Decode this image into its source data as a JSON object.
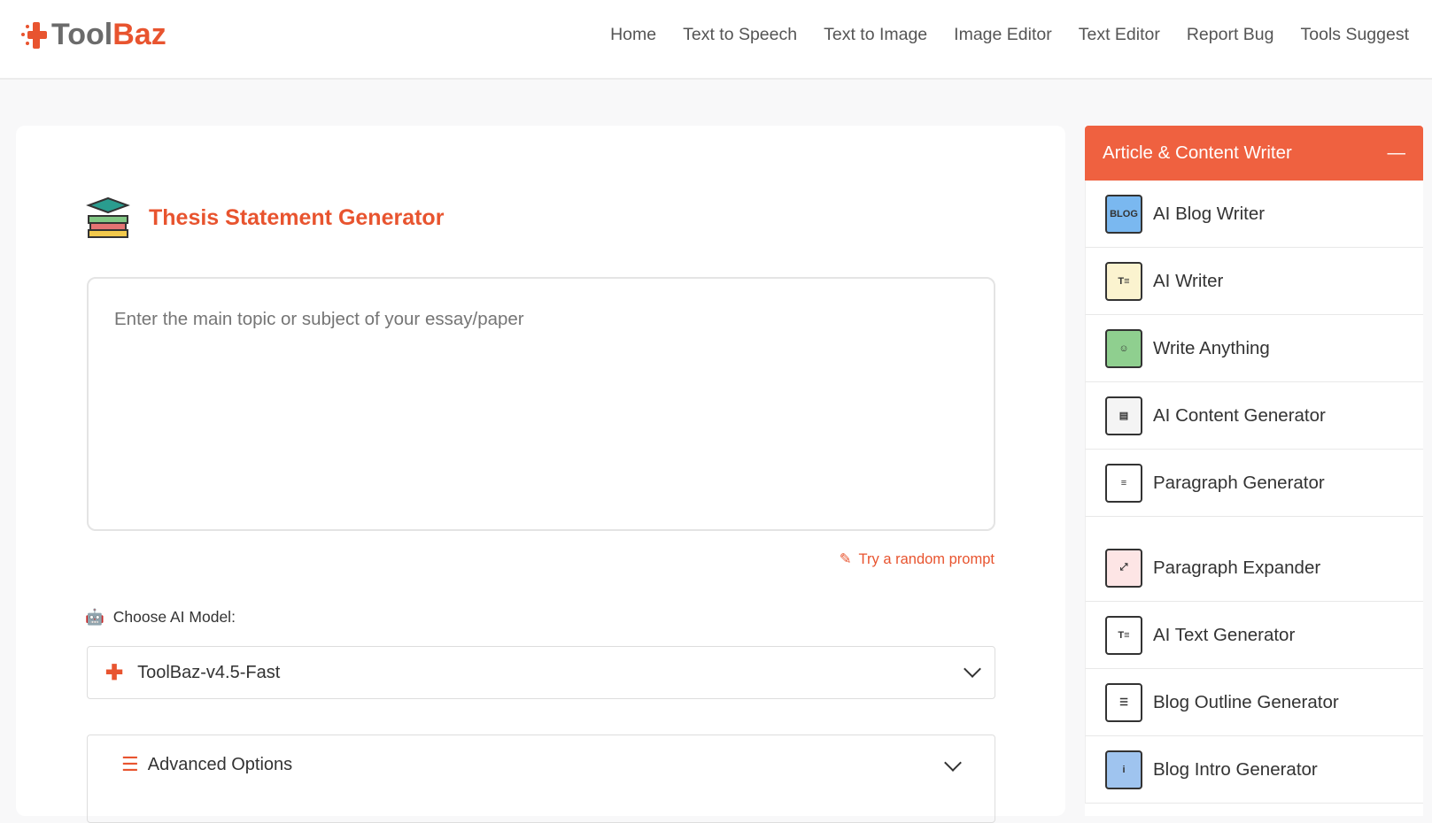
{
  "brand": {
    "part1": "Tool",
    "part2": "Baz"
  },
  "nav": [
    "Home",
    "Text to Speech",
    "Text to Image",
    "Image Editor",
    "Text Editor",
    "Report Bug",
    "Tools Suggest"
  ],
  "main": {
    "title": "Thesis Statement Generator",
    "placeholder": "Enter the main topic or subject of your essay/paper",
    "random": "Try a random prompt",
    "model_label": "Choose AI Model:",
    "model_value": "ToolBaz-v4.5-Fast",
    "advanced": "Advanced Options"
  },
  "sidebar": {
    "header": "Article & Content Writer",
    "collapse": "—",
    "items": [
      {
        "label": "AI Blog Writer",
        "icon": "BLOG",
        "color": "#7ab8f0"
      },
      {
        "label": "AI Writer",
        "icon": "T≡",
        "color": "#fbf3cf"
      },
      {
        "label": "Write Anything",
        "icon": "☺",
        "color": "#8fcf8f"
      },
      {
        "label": "AI Content Generator",
        "icon": "▤",
        "color": "#f4f4f4"
      },
      {
        "label": "Paragraph Generator",
        "icon": "≡",
        "color": "#fff"
      },
      {
        "label": "Paragraph Expander",
        "icon": "⤢",
        "color": "#fde5e5"
      },
      {
        "label": "AI Text Generator",
        "icon": "T≡",
        "color": "#fff"
      },
      {
        "label": "Blog Outline Generator",
        "icon": "☰",
        "color": "#fff"
      },
      {
        "label": "Blog Intro Generator",
        "icon": "i",
        "color": "#9fc4ef"
      }
    ]
  }
}
